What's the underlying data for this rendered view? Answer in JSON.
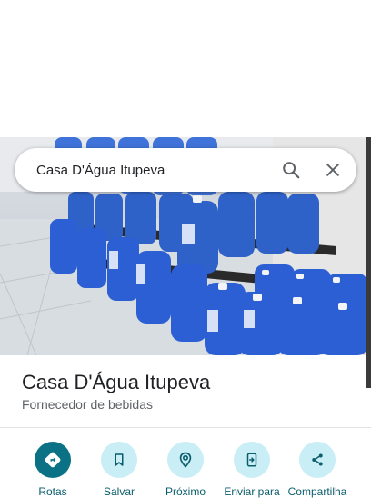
{
  "search": {
    "query": "Casa D'Água Itupeva"
  },
  "place": {
    "name": "Casa D'Água Itupeva",
    "category": "Fornecedor de bebidas"
  },
  "actions": [
    {
      "label": "Rotas",
      "icon": "directions-icon"
    },
    {
      "label": "Salvar",
      "icon": "bookmark-icon"
    },
    {
      "label": "Próximo",
      "icon": "nearby-icon"
    },
    {
      "label": "Enviar para",
      "icon": "send-to-phone-icon"
    },
    {
      "label": "Compartilha",
      "icon": "share-icon"
    }
  ],
  "colors": {
    "primary_action": "#0b7285",
    "action_tint": "#c9eef6",
    "action_label": "#0b5d6c"
  }
}
